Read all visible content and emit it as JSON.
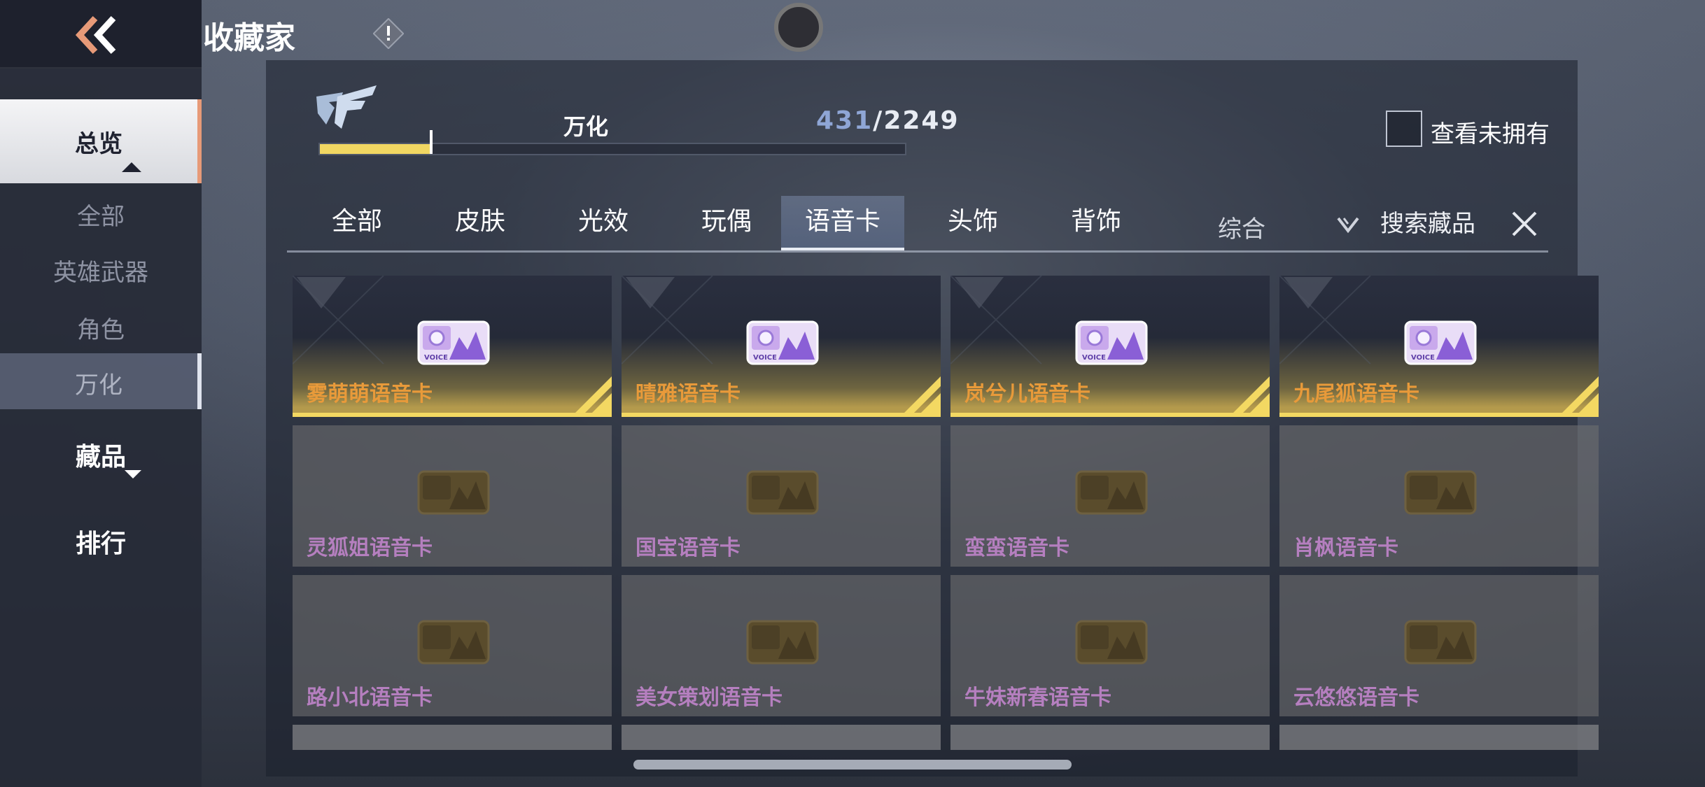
{
  "header": {
    "title": "收藏家",
    "back_icon": "double-chevron-left-icon",
    "info_icon": "exclamation-diamond-icon",
    "colors": {
      "accent": "#e79a78",
      "gold": "#f1d762"
    }
  },
  "sidebar": {
    "overview": "总览",
    "subitems": [
      "全部",
      "英雄武器",
      "角色",
      "万化"
    ],
    "active_subitem": "万化",
    "collection": "藏品",
    "ranking": "排行"
  },
  "progress": {
    "label": "万化",
    "current": "431",
    "separator": "/",
    "total": "2249",
    "fraction": 0.19
  },
  "filter": {
    "show_unowned_label": "查看未拥有",
    "show_unowned_checked": false
  },
  "tabs": {
    "items": [
      "全部",
      "皮肤",
      "光效",
      "玩偶",
      "语音卡",
      "头饰",
      "背饰"
    ],
    "active": "语音卡"
  },
  "sort": {
    "label": "综合"
  },
  "search": {
    "placeholder": "搜索藏品"
  },
  "cards": [
    {
      "name": "雾萌萌语音卡",
      "owned": true
    },
    {
      "name": "晴雅语音卡",
      "owned": true
    },
    {
      "name": "岚兮儿语音卡",
      "owned": true
    },
    {
      "name": "九尾狐语音卡",
      "owned": true
    },
    {
      "name": "灵狐姐语音卡",
      "owned": false
    },
    {
      "name": "国宝语音卡",
      "owned": false
    },
    {
      "name": "蛮蛮语音卡",
      "owned": false
    },
    {
      "name": "肖枫语音卡",
      "owned": false
    },
    {
      "name": "路小北语音卡",
      "owned": false
    },
    {
      "name": "美女策划语音卡",
      "owned": false
    },
    {
      "name": "牛妹新春语音卡",
      "owned": false
    },
    {
      "name": "云悠悠语音卡",
      "owned": false
    }
  ],
  "voice_card_icon_text": "VOICE"
}
